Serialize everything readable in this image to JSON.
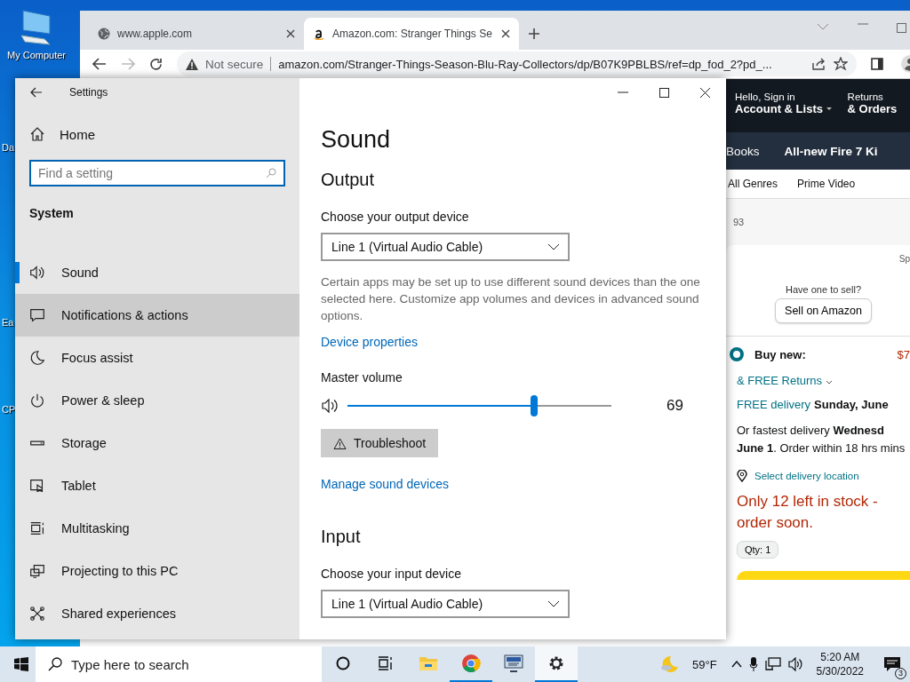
{
  "desktop": {
    "icons": [
      {
        "label": "My Computer"
      },
      {
        "label": "Da"
      },
      {
        "label": "Ea"
      },
      {
        "label": "CP"
      }
    ]
  },
  "browser": {
    "tabs": [
      {
        "title": "www.apple.com",
        "selected": false
      },
      {
        "title": "Amazon.com: Stranger Things Se",
        "selected": true
      }
    ],
    "security": "Not secure",
    "url": "amazon.com/Stranger-Things-Season-Blu-Ray-Collectors/dp/B07K9PBLBS/ref=dp_fod_2?pd_...",
    "page": {
      "greeting": "Hello, Sign in",
      "account": "Account & Lists",
      "returns": "Returns",
      "orders": "& Orders",
      "nav": [
        "Books",
        "All-new Fire 7 Ki"
      ],
      "subnav": [
        "All Genres",
        "Prime Video"
      ],
      "rating_count": "93",
      "cut_label": "Sp",
      "sell_prompt": "Have one to sell?",
      "sell_button": "Sell on Amazon",
      "buy_option": {
        "label": "Buy new:",
        "price": "$7",
        "selected": true
      },
      "free_returns": "& FREE Returns",
      "free_delivery": "FREE delivery",
      "delivery_date": "Sunday, June",
      "fastest": "Or fastest delivery **Wednesd June 1**. Order within 18 hrs mins",
      "location": "Select delivery location",
      "stock": "Only 12 left in stock - order soon.",
      "qty": "Qty: 1"
    }
  },
  "settings": {
    "title": "Settings",
    "home": "Home",
    "search": {
      "placeholder": "Find a setting"
    },
    "section": "System",
    "nav": [
      {
        "label": "Sound",
        "selected": true,
        "hovered": false
      },
      {
        "label": "Notifications & actions",
        "selected": false,
        "hovered": true
      },
      {
        "label": "Focus assist",
        "selected": false,
        "hovered": false
      },
      {
        "label": "Power & sleep",
        "selected": false,
        "hovered": false
      },
      {
        "label": "Storage",
        "selected": false,
        "hovered": false
      },
      {
        "label": "Tablet",
        "selected": false,
        "hovered": false
      },
      {
        "label": "Multitasking",
        "selected": false,
        "hovered": false
      },
      {
        "label": "Projecting to this PC",
        "selected": false,
        "hovered": false
      },
      {
        "label": "Shared experiences",
        "selected": false,
        "hovered": false
      }
    ],
    "page_title": "Sound",
    "output": {
      "heading": "Output",
      "device_label": "Choose your output device",
      "device": "Line 1 (Virtual Audio Cable)",
      "note": "Certain apps may be set up to use different sound devices than the one selected here. Customize app volumes and devices in advanced sound options.",
      "properties_link": "Device properties",
      "volume_label": "Master volume",
      "volume": {
        "level": 0.69,
        "reading": "69"
      },
      "troubleshoot": "Troubleshoot",
      "manage_link": "Manage sound devices"
    },
    "input": {
      "heading": "Input",
      "device_label": "Choose your input device",
      "device": "Line 1 (Virtual Audio Cable)"
    }
  },
  "taskbar": {
    "search": {
      "placeholder": "Type here to search"
    },
    "apps": [
      {
        "kind": "cortana",
        "running": false,
        "selected": false
      },
      {
        "kind": "taskview",
        "running": false,
        "selected": false
      },
      {
        "kind": "explorer",
        "running": false,
        "selected": false
      },
      {
        "kind": "chrome",
        "running": true,
        "selected": false
      },
      {
        "kind": "remote",
        "running": false,
        "selected": false
      },
      {
        "kind": "settings",
        "running": true,
        "selected": true
      }
    ],
    "temperature": "59°F",
    "time": "5:20 AM",
    "date": "5/30/2022",
    "notifications": "3"
  }
}
